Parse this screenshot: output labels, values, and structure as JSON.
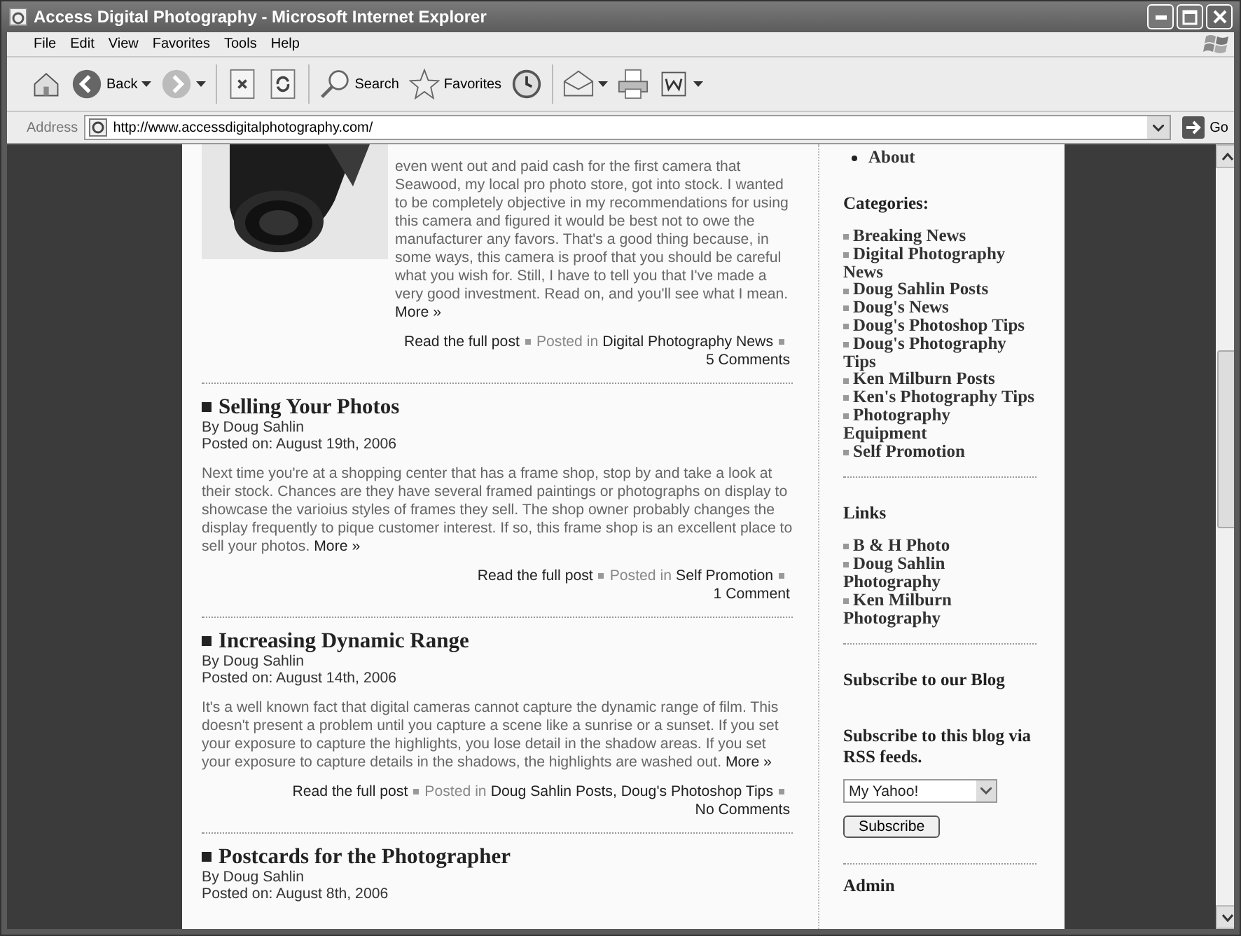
{
  "window": {
    "title": "Access Digital Photography - Microsoft Internet Explorer"
  },
  "menu": [
    "File",
    "Edit",
    "View",
    "Favorites",
    "Tools",
    "Help"
  ],
  "toolbar": [
    {
      "kind": "home",
      "dropdown": false
    },
    {
      "kind": "back",
      "label": "Back",
      "dropdown": true
    },
    {
      "kind": "forward",
      "dropdown": true
    },
    {
      "kind": "stop",
      "dropdown": false
    },
    {
      "kind": "refresh",
      "dropdown": false
    },
    {
      "kind": "search",
      "label": "Search",
      "dropdown": false
    },
    {
      "kind": "favorites",
      "label": "Favorites",
      "dropdown": false
    },
    {
      "kind": "history",
      "dropdown": false
    },
    {
      "kind": "mail",
      "dropdown": true
    },
    {
      "kind": "print",
      "dropdown": false
    },
    {
      "kind": "word",
      "dropdown": true
    }
  ],
  "address": {
    "label": "Address",
    "url": "http://www.accessdigitalphotography.com/",
    "go": "Go"
  },
  "posts": [
    {
      "kind": "picture",
      "body": "even went out and paid cash for the first camera that Seawood, my local pro photo store, got into stock. I wanted to be completely objective in my recommendations for using this camera and figured it would be best not to owe the manufacturer any favors. That's a good thing because, in some ways, this camera is proof that you should be careful what you wish for. Still, I have to tell you that I've made a very good investment. Read on, and you'll see what I mean.",
      "more": "More »",
      "read": "Read the full post",
      "posted_in": "Posted in",
      "categories": "Digital Photography News",
      "comments": "5 Comments"
    },
    {
      "title": "Selling Your Photos",
      "author": "By Doug Sahlin",
      "date": "Posted on: August 19th, 2006",
      "body": "Next time you're at a shopping center that has a frame shop, stop by and take a look at their stock. Chances are they have several framed paintings or photographs on display to showcase the varioius styles of frames they sell. The shop owner probably changes the display frequently to pique customer interest. If so, this frame shop is an excellent place to sell your photos.",
      "more": "More »",
      "read": "Read the full post",
      "posted_in": "Posted in",
      "categories": "Self Promotion",
      "comments": "1 Comment"
    },
    {
      "title": "Increasing Dynamic Range",
      "author": "By Doug Sahlin",
      "date": "Posted on: August 14th, 2006",
      "body": "It's a well known fact that digital cameras cannot capture the dynamic range of film. This doesn't present a problem until you capture a scene like a sunrise or a sunset. If you set your exposure to capture the highlights, you lose detail in the shadow areas. If you set your exposure to capture details in the shadows, the highlights are washed out.",
      "more": "More »",
      "read": "Read the full post",
      "posted_in": "Posted in",
      "categories": "Doug Sahlin Posts, Doug's Photoshop Tips",
      "comments": "No Comments"
    },
    {
      "title": "Postcards for the Photographer",
      "author": "By Doug Sahlin",
      "date": "Posted on: August 8th, 2006"
    }
  ],
  "sidebar": {
    "pages": [
      "About"
    ],
    "categories": {
      "heading": "Categories:",
      "items": [
        "Breaking News",
        "Digital Photography News",
        "Doug Sahlin Posts",
        "Doug's News",
        "Doug's Photoshop Tips",
        "Doug's Photography Tips",
        "Ken Milburn Posts",
        "Ken's Photography Tips",
        "Photography Equipment",
        "Self Promotion"
      ]
    },
    "links": {
      "heading": "Links",
      "items": [
        "B & H Photo",
        "Doug Sahlin Photography",
        "Ken Milburn Photography"
      ]
    },
    "subscribe_heading": "Subscribe to our Blog",
    "rss": {
      "heading": "Subscribe to this blog via RSS feeds.",
      "select": "My Yahoo!",
      "button": "Subscribe"
    },
    "admin_heading": "Admin"
  }
}
